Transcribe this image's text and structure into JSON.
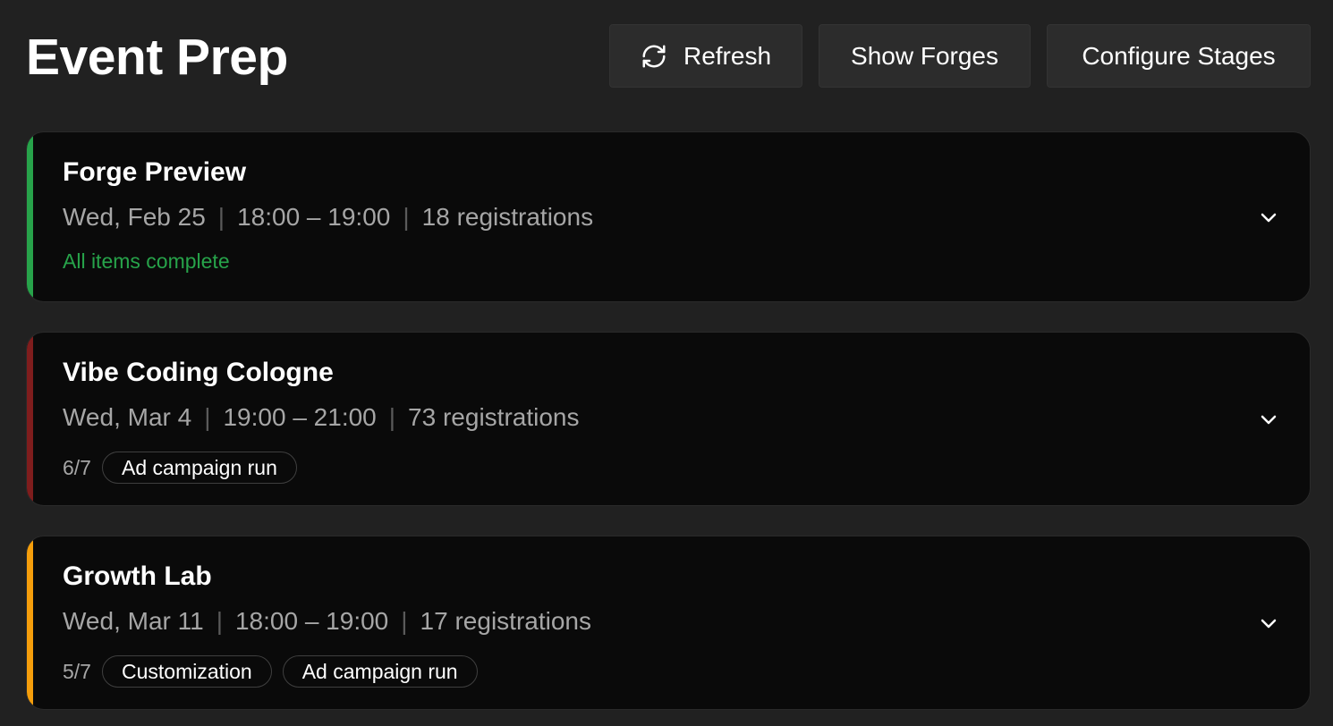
{
  "header": {
    "title": "Event Prep",
    "buttons": {
      "refresh": "Refresh",
      "show_forges": "Show Forges",
      "configure_stages": "Configure Stages"
    }
  },
  "colors": {
    "complete": "#27a34a",
    "overdue": "#7f1d1d",
    "in_progress": "#f59e0b"
  },
  "events": [
    {
      "title": "Forge Preview",
      "date": "Wed, Feb 25",
      "time": "18:00 – 19:00",
      "registrations": "18 registrations",
      "status_text": "All items complete",
      "status_color": "#27a34a"
    },
    {
      "title": "Vibe Coding Cologne",
      "date": "Wed, Mar 4",
      "time": "19:00 – 21:00",
      "registrations": "73 registrations",
      "progress": "6/7",
      "pending_items": [
        "Ad campaign run"
      ],
      "status_color": "#7f1d1d"
    },
    {
      "title": "Growth Lab",
      "date": "Wed, Mar 11",
      "time": "18:00 – 19:00",
      "registrations": "17 registrations",
      "progress": "5/7",
      "pending_items": [
        "Customization",
        "Ad campaign run"
      ],
      "status_color": "#f59e0b"
    }
  ],
  "icons": {
    "refresh": "refresh-icon",
    "expand": "chevron-down-icon"
  }
}
